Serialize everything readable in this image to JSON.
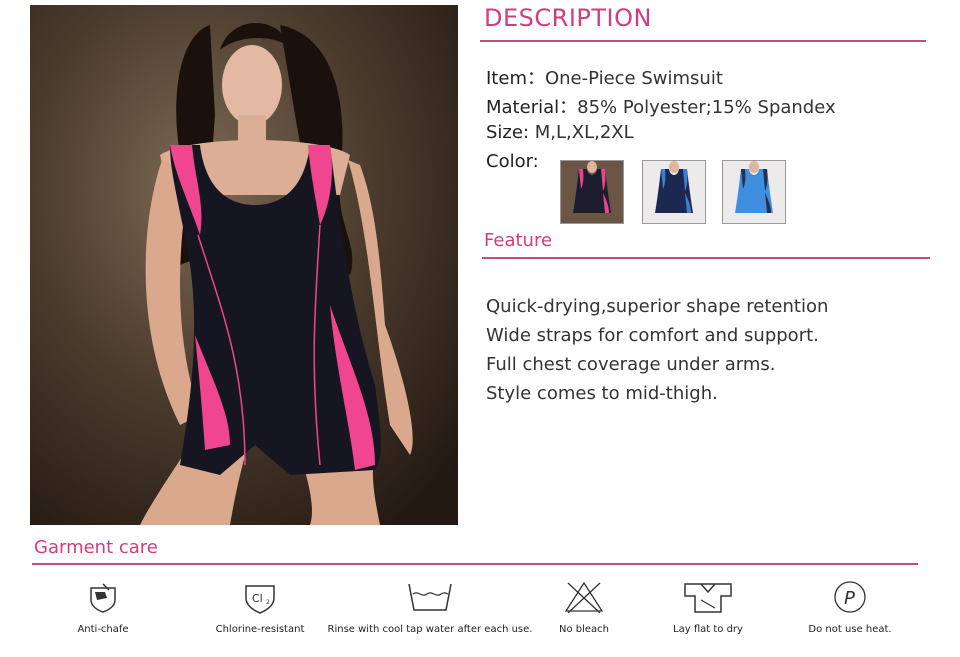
{
  "description": {
    "title": "DESCRIPTION",
    "item_label": "Item",
    "item_value": "One-Piece Swimsuit",
    "material_label": "Material",
    "material_value": "85% Polyester;15% Spandex",
    "size_label": "Size:",
    "size_value": "M,L,XL,2XL",
    "color_label": "Color:",
    "swatches": [
      {
        "name": "black-pink",
        "body": "#1b1d2e",
        "accent": "#e8458c"
      },
      {
        "name": "navy-blue",
        "body": "#1c2850",
        "accent": "#3b7fd1"
      },
      {
        "name": "blue",
        "body": "#3f8ee0",
        "accent": "#26314f"
      }
    ]
  },
  "feature": {
    "title": "Feature",
    "lines": [
      "Quick-drying,superior shape retention",
      "Wide straps for comfort and support.",
      "Full chest coverage under arms.",
      "Style comes to mid-thigh."
    ]
  },
  "care": {
    "title": "Garment care",
    "items": [
      {
        "icon": "anti-chafe-icon",
        "label": "Anti-chafe"
      },
      {
        "icon": "chlorine-resistant-icon",
        "label": "Chlorine-resistant"
      },
      {
        "icon": "wash-tub-icon",
        "label": "Rinse with cool tap water after each use."
      },
      {
        "icon": "no-bleach-icon",
        "label": "No bleach"
      },
      {
        "icon": "lay-flat-icon",
        "label": "Lay flat to dry"
      },
      {
        "icon": "no-heat-icon",
        "label": "Do not use heat."
      }
    ]
  },
  "colors": {
    "accent": "#d13d7c",
    "rule": "#c24d80",
    "swimsuit_body": "#151621",
    "swimsuit_accent": "#f0468f"
  }
}
